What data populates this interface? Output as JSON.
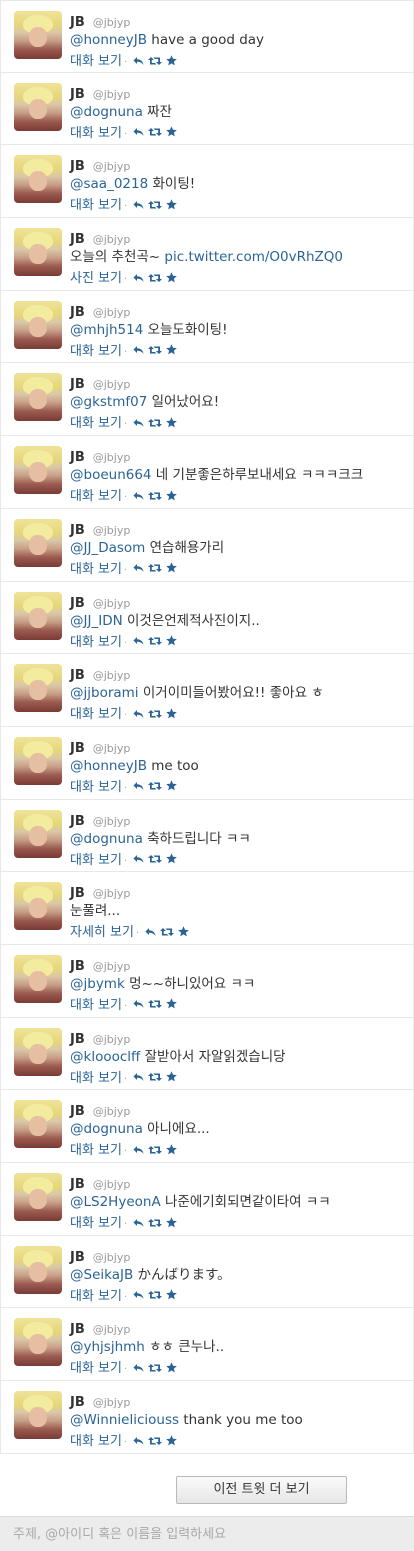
{
  "user": {
    "name": "JB",
    "handle": "@jbjyp"
  },
  "colors": {
    "link": "#2a6496",
    "icon": "#2a6496",
    "border": "#e8e8e8"
  },
  "icons": [
    "reply-icon",
    "retweet-icon",
    "favorite-icon"
  ],
  "tweets": [
    {
      "mention": "@honneyJB",
      "body": " have a good day",
      "view_label": "대화 보기"
    },
    {
      "mention": "@dognuna",
      "body": " 짜잔",
      "view_label": "대화 보기"
    },
    {
      "mention": "@saa_0218",
      "body": " 화이팅!",
      "view_label": "대화 보기"
    },
    {
      "mention": "",
      "body": "오늘의 추천곡~ ",
      "link": "pic.twitter.com/O0vRhZQ0",
      "view_label": "사진 보기"
    },
    {
      "mention": "@mhjh514",
      "body": " 오늘도화이팅!",
      "view_label": "대화 보기"
    },
    {
      "mention": "@gkstmf07",
      "body": " 일어났어요!",
      "view_label": "대화 보기"
    },
    {
      "mention": "@boeun664",
      "body": " 네 기분좋은하루보내세요 ㅋㅋㅋ크크",
      "view_label": "대화 보기"
    },
    {
      "mention": "@JJ_Dasom",
      "body": " 연습해용가리",
      "view_label": "대화 보기"
    },
    {
      "mention": "@JJ_IDN",
      "body": " 이것은언제적사진이지..",
      "view_label": "대화 보기"
    },
    {
      "mention": "@jjborami",
      "body": " 이거이미들어봤어요!! 좋아요 ㅎ",
      "view_label": "대화 보기"
    },
    {
      "mention": "@honneyJB",
      "body": " me too",
      "view_label": "대화 보기"
    },
    {
      "mention": "@dognuna",
      "body": " 축하드립니다 ㅋㅋ",
      "view_label": "대화 보기"
    },
    {
      "mention": "",
      "body": "눈풀려...",
      "view_label": "자세히 보기"
    },
    {
      "mention": "@jbymk",
      "body": " 멍~~하니있어요 ㅋㅋ",
      "view_label": "대화 보기"
    },
    {
      "mention": "@kloooclff",
      "body": " 잘받아서 자알읽겠습니당",
      "view_label": "대화 보기"
    },
    {
      "mention": "@dognuna",
      "body": " 아니에요...",
      "view_label": "대화 보기"
    },
    {
      "mention": "@LS2HyeonA",
      "body": " 나준에기회되면같이타여 ㅋㅋ",
      "view_label": "대화 보기"
    },
    {
      "mention": "@SeikaJB",
      "body": " かんばります。",
      "view_label": "대화 보기"
    },
    {
      "mention": "@yhjsjhmh",
      "body": " ㅎㅎ 큰누나..",
      "view_label": "대화 보기"
    },
    {
      "mention": "@Winnieliciouss",
      "body": " thank you me too",
      "view_label": "대화 보기"
    }
  ],
  "more_button_label": "이전 트윗 더 보기",
  "compose": {
    "placeholder": "주제, @아이디 혹은 이름을 입력하세요"
  }
}
